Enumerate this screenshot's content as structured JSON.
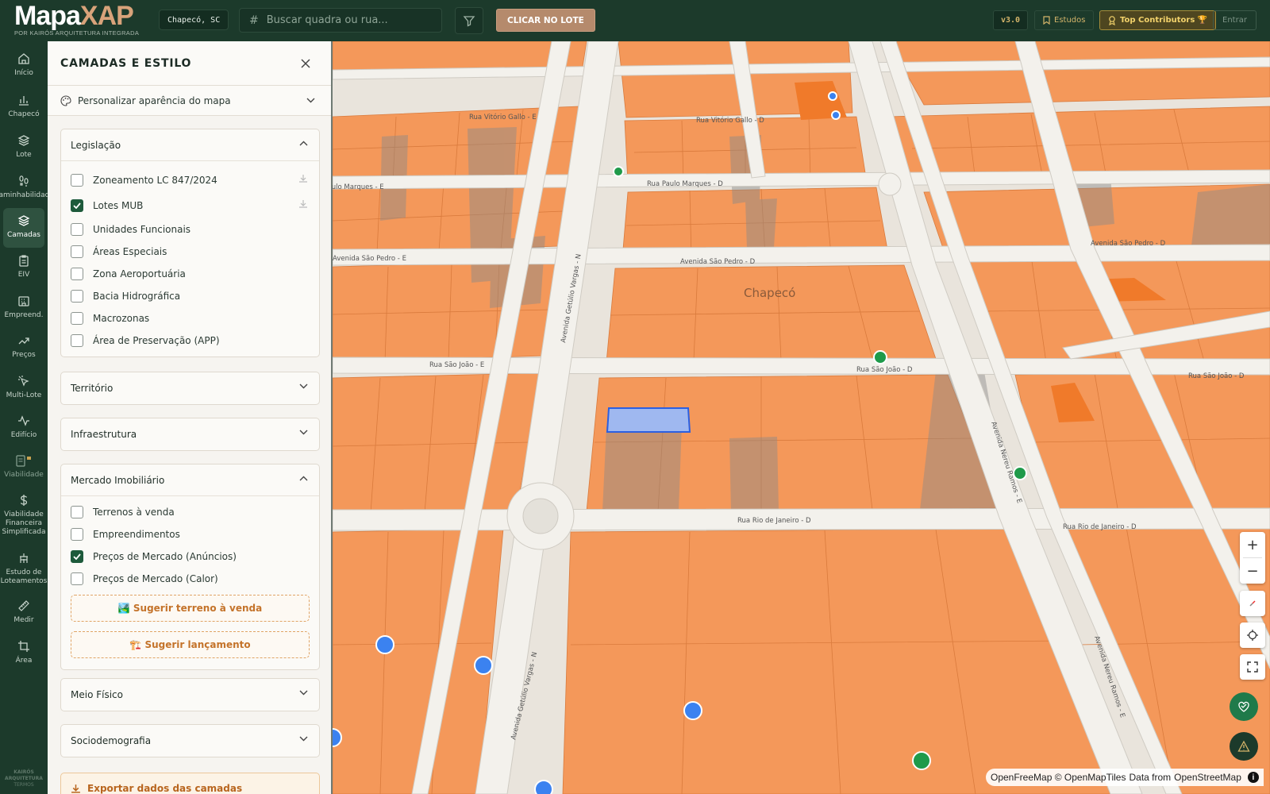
{
  "header": {
    "logo_main": "Mapa",
    "logo_accent": "XAP",
    "logo_sub": "POR KAIRÓS ARQUITETURA INTEGRADA",
    "city": "Chapecó, SC",
    "search_placeholder": "Buscar quadra ou rua...",
    "lote_button": "CLICAR NO LOTE",
    "version": "v3.0",
    "estudos": "Estudos",
    "top_contributors": "Top Contributors 🏆",
    "entrar": "Entrar"
  },
  "nav": [
    {
      "label": "Início",
      "icon": "home-icon"
    },
    {
      "label": "Chapecó",
      "icon": "bar-chart-icon"
    },
    {
      "label": "Lote",
      "icon": "layers-icon"
    },
    {
      "label": "Caminhabilidade",
      "icon": "footprints-icon"
    },
    {
      "label": "Camadas",
      "icon": "layers-icon"
    },
    {
      "label": "EIV",
      "icon": "clipboard-icon"
    },
    {
      "label": "Empreend.",
      "icon": "building-icon"
    },
    {
      "label": "Preços",
      "icon": "trend-up-icon"
    },
    {
      "label": "Multi-Lote",
      "icon": "pointer-icon"
    },
    {
      "label": "Edifício",
      "icon": "pulse-icon"
    },
    {
      "label": "Viabilidade",
      "icon": "document-lock-icon"
    },
    {
      "label": "Viabilidade Financeira Simplificada",
      "icon": "dollar-icon"
    },
    {
      "label": "Estudo de Loteamentos",
      "icon": "grid-icon"
    },
    {
      "label": "Medir",
      "icon": "ruler-icon"
    },
    {
      "label": "Área",
      "icon": "crop-icon"
    }
  ],
  "nav_footer": [
    "KAIRÓS",
    "ARQUITETURA",
    "TERMOS"
  ],
  "panel": {
    "title": "CAMADAS E ESTILO",
    "customize": "Personalizar aparência do mapa",
    "groups": {
      "legislacao": {
        "title": "Legislação",
        "layers": [
          {
            "label": "Zoneamento LC 847/2024",
            "checked": false
          },
          {
            "label": "Lotes MUB",
            "checked": true
          },
          {
            "label": "Unidades Funcionais",
            "checked": false
          },
          {
            "label": "Áreas Especiais",
            "checked": false
          },
          {
            "label": "Zona Aeroportuária",
            "checked": false
          },
          {
            "label": "Bacia Hidrográfica",
            "checked": false
          },
          {
            "label": "Macrozonas",
            "checked": false
          },
          {
            "label": "Área de Preservação (APP)",
            "checked": false
          }
        ]
      },
      "territorio": {
        "title": "Território"
      },
      "infraestrutura": {
        "title": "Infraestrutura"
      },
      "mercado": {
        "title": "Mercado Imobiliário",
        "layers": [
          {
            "label": "Terrenos à venda",
            "checked": false
          },
          {
            "label": "Empreendimentos",
            "checked": false
          },
          {
            "label": "Preços de Mercado (Anúncios)",
            "checked": true
          },
          {
            "label": "Preços de Mercado (Calor)",
            "checked": false
          }
        ],
        "suggest_land": "🏞️ Sugerir terreno à venda",
        "suggest_launch": "🏗️ Sugerir lançamento"
      },
      "meio_fisico": {
        "title": "Meio Físico"
      },
      "sociodemografia": {
        "title": "Sociodemografia"
      }
    },
    "export": "Exportar dados das camadas"
  },
  "map": {
    "city_label": "Chapecó",
    "streets": {
      "vitorio_gallo": "Rua Vitório Gallo - D",
      "vitorio_gallo_e": "Rua Vitório Gallo - E",
      "paulo_marques_e": "Rua Paulo Marques - E",
      "paulo_marques_d": "Rua Paulo Marques - D",
      "sao_pedro_e": "Avenida São Pedro - E",
      "sao_pedro_d": "Avenida São Pedro - D",
      "sao_pedro_d2": "Avenida São Pedro - D",
      "sao_joao_e": "Rua São João - E",
      "sao_joao_d": "Rua São João - D",
      "sao_joao_d2": "Rua São João - D",
      "rio_janeiro_d": "Rua Rio de Janeiro - D",
      "rio_janeiro_d2": "Rua Rio de Janeiro - D",
      "getulio_n": "Avenida Getúlio Vargas - N",
      "getulio_n2": "Avenida Getúlio Vargas - N",
      "nereu_e": "Avenida Nereu Ramos - E",
      "nereu_e2": "Avenida Nereu Ramos - E"
    },
    "attribution": {
      "omt": "OpenFreeMap © OpenMapTiles",
      "data": "Data from",
      "osm": "OpenStreetMap"
    },
    "colors": {
      "lot": "#f4985a",
      "lot_dark": "#f07a2a",
      "road": "#f3f1ec",
      "selected": "#9fb8f0",
      "marker_blue": "#3b82f0",
      "marker_green": "#1f9a4a"
    }
  }
}
